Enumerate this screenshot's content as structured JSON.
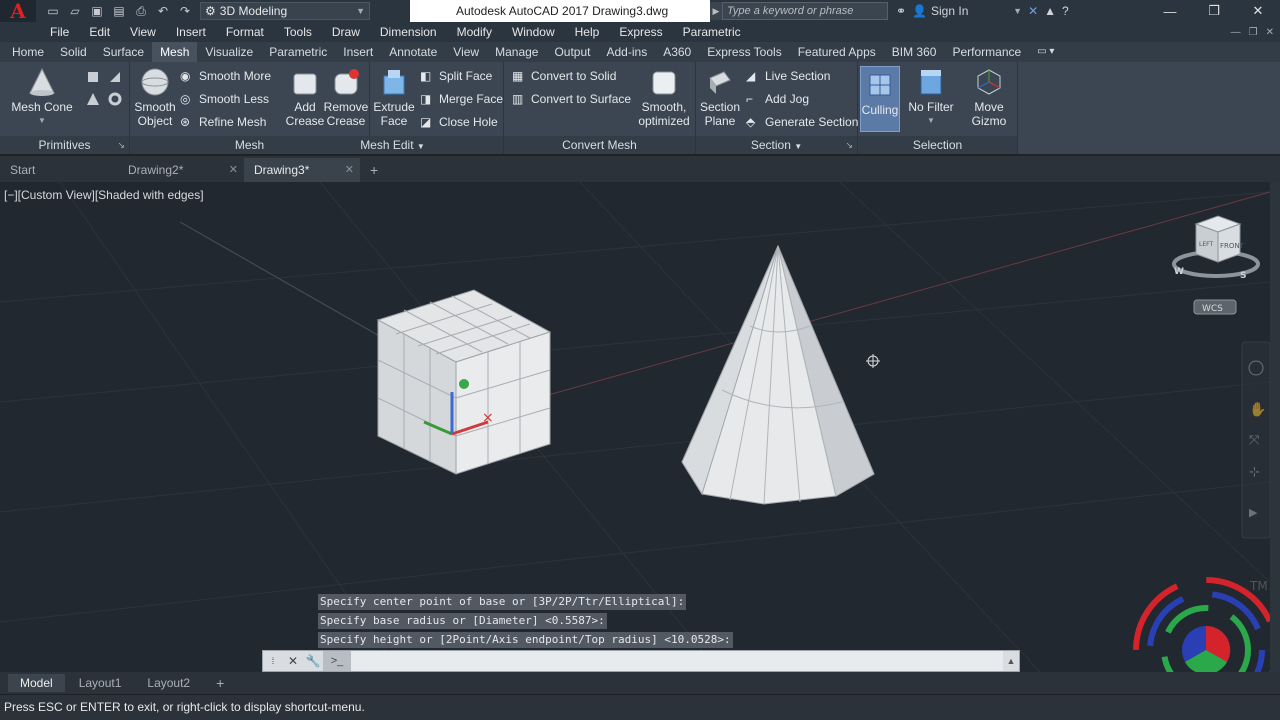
{
  "app": {
    "logo_letter": "A",
    "title": "Autodesk AutoCAD 2017    Drawing3.dwg",
    "workspace": "3D Modeling",
    "search_placeholder": "Type a keyword or phrase",
    "sign_in": "Sign In"
  },
  "menu": [
    "File",
    "Edit",
    "View",
    "Insert",
    "Format",
    "Tools",
    "Draw",
    "Dimension",
    "Modify",
    "Window",
    "Help",
    "Express",
    "Parametric"
  ],
  "ribbon_tabs": [
    "Home",
    "Solid",
    "Surface",
    "Mesh",
    "Visualize",
    "Parametric",
    "Insert",
    "Annotate",
    "View",
    "Manage",
    "Output",
    "Add-ins",
    "A360",
    "Express Tools",
    "Featured Apps",
    "BIM 360",
    "Performance"
  ],
  "active_ribbon_tab": "Mesh",
  "panels": {
    "primitives": {
      "title": "Primitives",
      "mesh_cone": "Mesh Cone"
    },
    "mesh": {
      "title": "Mesh",
      "smooth_object_1": "Smooth",
      "smooth_object_2": "Object",
      "smooth_more": "Smooth More",
      "smooth_less": "Smooth Less",
      "refine_mesh": "Refine Mesh"
    },
    "mesh_edit": {
      "title": "Mesh Edit",
      "add_crease_1": "Add",
      "add_crease_2": "Crease",
      "remove_crease_1": "Remove",
      "remove_crease_2": "Crease",
      "extrude_face_1": "Extrude",
      "extrude_face_2": "Face",
      "split_face": "Split Face",
      "merge_face": "Merge Face",
      "close_hole": "Close Hole"
    },
    "convert_mesh": {
      "title": "Convert Mesh",
      "convert_to_solid": "Convert to Solid",
      "convert_to_surface": "Convert to Surface",
      "smooth_optimized_1": "Smooth,",
      "smooth_optimized_2": "optimized"
    },
    "section": {
      "title": "Section",
      "section_plane_1": "Section",
      "section_plane_2": "Plane",
      "live_section": "Live Section",
      "add_jog": "Add Jog",
      "generate_section": "Generate Section"
    },
    "selection": {
      "title": "Selection",
      "culling": "Culling",
      "no_filter": "No Filter",
      "move_gizmo_1": "Move",
      "move_gizmo_2": "Gizmo"
    }
  },
  "file_tabs": [
    {
      "label": "Start"
    },
    {
      "label": "Drawing2*"
    },
    {
      "label": "Drawing3*"
    }
  ],
  "viewport": {
    "label": "[−][Custom View][Shaded with edges]",
    "viewcube_face": "FRONT",
    "viewcube_side": "LEFT",
    "wcs": "WCS",
    "compass_w": "W",
    "compass_s": "S"
  },
  "command_history": [
    "Specify center point of base or [3P/2P/Ttr/Elliptical]:",
    "Specify base radius or [Diameter] <0.5587>:",
    "Specify height or [2Point/Axis endpoint/Top radius] <10.0528>:"
  ],
  "layout_tabs": [
    "Model",
    "Layout1",
    "Layout2"
  ],
  "status": "Press ESC or ENTER to exit, or right-click to display shortcut-menu.",
  "watermark": "TM"
}
